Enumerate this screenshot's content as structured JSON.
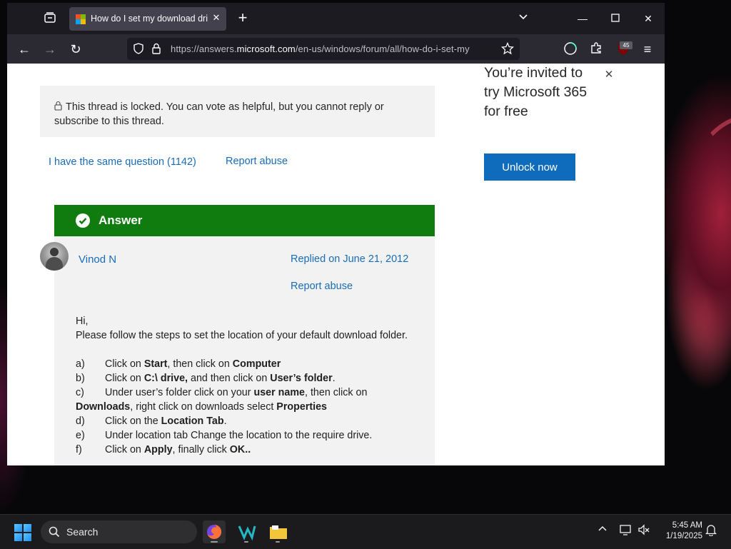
{
  "browser": {
    "tab_title": "How do I set my download drive",
    "url_prefix": "https://answers.",
    "url_domain": "microsoft.com",
    "url_suffix": "/en-us/windows/forum/all/how-do-i-set-my",
    "extension_badge": "45"
  },
  "thread": {
    "locked_notice": "This thread is locked. You can vote as helpful, but you cannot reply or subscribe to this thread.",
    "same_question": "I have the same question (1142)",
    "report_abuse": "Report abuse"
  },
  "answer": {
    "label": "Answer",
    "author": "Vinod N",
    "replied": "Replied on June 21, 2012",
    "report_abuse": "Report abuse",
    "greeting": "Hi,",
    "intro": "Please follow the steps to set the location of your default download folder.",
    "steps": [
      {
        "letter": "a)",
        "parts": [
          [
            "Click on ",
            false
          ],
          [
            "Start",
            true
          ],
          [
            ", then click on ",
            false
          ],
          [
            "Computer",
            true
          ]
        ]
      },
      {
        "letter": "b)",
        "parts": [
          [
            "Click on ",
            false
          ],
          [
            "C:\\ drive,",
            true
          ],
          [
            " and then click on ",
            false
          ],
          [
            "User’s folder",
            true
          ],
          [
            ".",
            false
          ]
        ]
      },
      {
        "letter": "c)",
        "parts": [
          [
            "Under user’s folder click on your ",
            false
          ],
          [
            "user name",
            true
          ],
          [
            ", then click on ",
            false
          ],
          [
            "Downloads",
            true
          ],
          [
            ", right click on downloads select ",
            false
          ],
          [
            "Properties",
            true
          ]
        ]
      },
      {
        "letter": "d)",
        "parts": [
          [
            "Click on the ",
            false
          ],
          [
            "Location Tab",
            true
          ],
          [
            ".",
            false
          ]
        ]
      },
      {
        "letter": "e)",
        "parts": [
          [
            "Under location tab Change the location to the require drive.",
            false
          ]
        ]
      },
      {
        "letter": "f)",
        "parts": [
          [
            "Click on ",
            false
          ],
          [
            "Apply",
            true
          ],
          [
            ", finally click ",
            false
          ],
          [
            "OK..",
            true
          ]
        ]
      }
    ]
  },
  "ad": {
    "title": "You’re invited to try Microsoft 365 for free",
    "button": "Unlock now"
  },
  "taskbar": {
    "search_label": "Search",
    "time": "5:45 AM",
    "date": "1/19/2025"
  },
  "colors": {
    "answer_green": "#107c10",
    "link_blue": "#1a6cb8",
    "ad_button": "#0f6cbd"
  }
}
